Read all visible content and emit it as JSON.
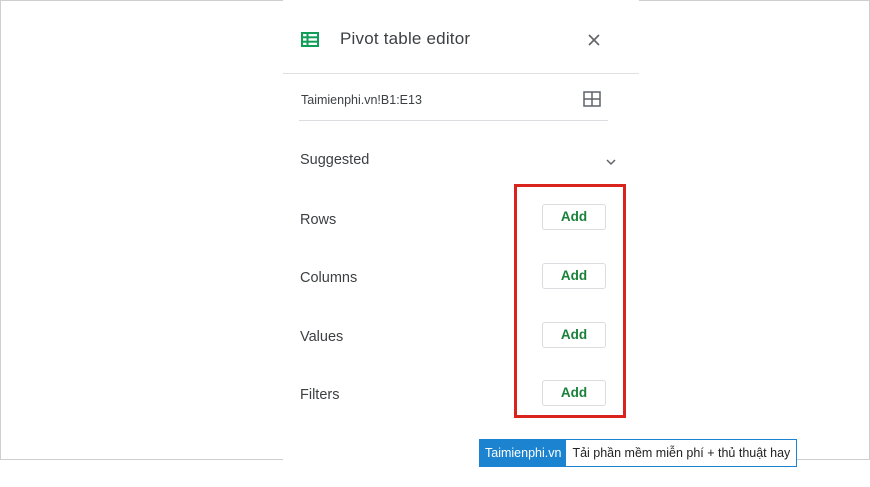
{
  "header": {
    "title": "Pivot table editor",
    "icon": "sheets-table-icon",
    "close_icon": "close-icon"
  },
  "range": {
    "value": "Taimienphi.vn!B1:E13",
    "select_icon": "grid-icon"
  },
  "suggested": {
    "label": "Suggested",
    "icon": "chevron-down-icon"
  },
  "sections": [
    {
      "label": "Rows",
      "button": "Add"
    },
    {
      "label": "Columns",
      "button": "Add"
    },
    {
      "label": "Values",
      "button": "Add"
    },
    {
      "label": "Filters",
      "button": "Add"
    }
  ],
  "watermark": {
    "brand": "Taimienphi.vn",
    "tagline": "Tải phần mềm miễn phí + thủ thuật hay"
  },
  "colors": {
    "accent_green": "#188038",
    "sheets_green": "#0f9d58",
    "highlight_red": "#d9231d",
    "watermark_blue": "#1b83cf"
  }
}
